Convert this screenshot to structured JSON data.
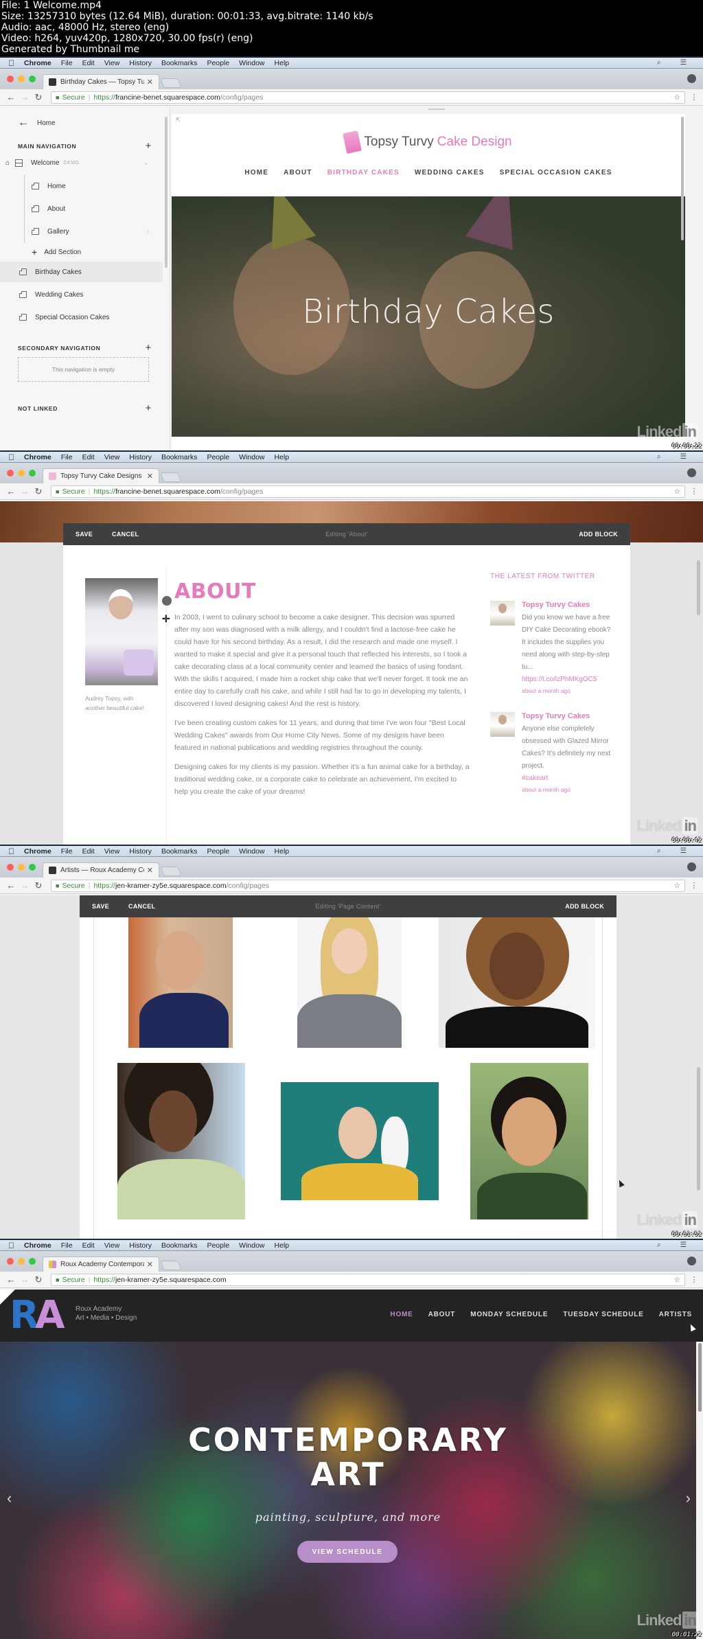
{
  "file_info": {
    "lines": [
      "File: 1 Welcome.mp4",
      "Size: 13257310 bytes (12.64 MiB), duration: 00:01:33, avg.bitrate: 1140 kb/s",
      "Audio: aac, 48000 Hz, stereo (eng)",
      "Video: h264, yuv420p, 1280x720, 30.00 fps(r) (eng)",
      "Generated by Thumbnail me"
    ]
  },
  "menubar": {
    "apple": "",
    "app": "Chrome",
    "items": [
      "File",
      "Edit",
      "View",
      "History",
      "Bookmarks",
      "People",
      "Window",
      "Help"
    ],
    "search_icon": "⌕",
    "list_icon": "☰"
  },
  "watermark": {
    "text": "Linked",
    "badge": "in"
  },
  "frames": [
    {
      "timestamp": "00:00:22",
      "tab_title": "Birthday Cakes — Topsy Turvy",
      "url": {
        "secure": "Secure",
        "scheme": "https://",
        "host": "francine-benet.squarespace.com",
        "path": "/config/pages"
      },
      "sidebar": {
        "home_label": "Home",
        "main_nav_label": "MAIN NAVIGATION",
        "welcome_label": "Welcome",
        "welcome_badge": "DEMO",
        "sub_items": [
          "Home",
          "About",
          "Gallery"
        ],
        "add_section": "Add Section",
        "pages": [
          "Birthday Cakes",
          "Wedding Cakes",
          "Special Occasion Cakes"
        ],
        "secondary_nav_label": "SECONDARY NAVIGATION",
        "secondary_empty": "This navigation is empty",
        "not_linked_label": "NOT LINKED"
      },
      "site": {
        "logo_main": "Topsy Turvy",
        "logo_accent": "Cake Design",
        "nav": [
          "HOME",
          "ABOUT",
          "BIRTHDAY CAKES",
          "WEDDING CAKES",
          "SPECIAL OCCASION CAKES"
        ],
        "active_nav": "BIRTHDAY CAKES",
        "hero_title": "Birthday Cakes"
      }
    },
    {
      "timestamp": "00:00:42",
      "tab_title": "Topsy Turvy Cake Designs",
      "url": {
        "secure": "Secure",
        "scheme": "https://",
        "host": "francine-benet.squarespace.com",
        "path": "/config/pages"
      },
      "editbar": {
        "save": "SAVE",
        "cancel": "CANCEL",
        "status": "Editing 'About'",
        "add_block": "ADD BLOCK"
      },
      "caption": "Audrey Topsy, with another beautiful cake!",
      "about_title": "ABOUT",
      "paragraphs": [
        "In 2003, I went to culinary school to become a cake designer. This decision was spurred after my son was diagnosed with a milk allergy, and I couldn't find a lactose-free cake he could have for his second birthday. As a result, I did the research and made one myself. I wanted to make it special and give it a personal touch that reflected his interests, so I took a cake decorating class at a local community center and learned the basics of using fondant. With the skills I acquired, I made him a rocket ship cake that we'll never forget. It took me an entire day to carefully craft his cake, and while I still had far to go in developing my talents, I discovered I loved designing cakes! And the rest is history.",
        "I've been creating custom cakes for 11 years, and during that time I've won four \"Best Local Wedding Cakes\" awards from Our Home City News. Some of my designs have been featured in national publications and wedding registries throughout the county.",
        "Designing cakes for my clients is my passion. Whether it's a fun animal cake for a birthday, a traditional wedding cake, or a corporate cake to celebrate an achievement, I'm excited to help you create the cake of your dreams!"
      ],
      "twitter": {
        "heading": "THE LATEST FROM TWITTER",
        "tweets": [
          {
            "name": "Topsy Turvy Cakes",
            "text": "Did you know we have a free DIY Cake Decorating ebook? It includes the supplies you need along with step-by-step tu...",
            "link": "https://t.co/lzPhMKgOC5",
            "time": "about a month ago"
          },
          {
            "name": "Topsy Turvy Cakes",
            "text": "Anyone else completely obsessed with Glazed Mirror Cakes? It's definitely my next project.",
            "link": "#cakeart",
            "time": "about a month ago"
          }
        ]
      }
    },
    {
      "timestamp": "00:01:02",
      "tab_title": "Artists — Roux Academy Cont",
      "url": {
        "secure": "Secure",
        "scheme": "https://",
        "host": "jen-kramer-zy5e.squarespace.com",
        "path": "/config/pages"
      },
      "editbar": {
        "save": "SAVE",
        "cancel": "CANCEL",
        "status": "Editing 'Page Content'",
        "add_block": "ADD BLOCK"
      },
      "artists": [
        "artist-1",
        "artist-2",
        "artist-3",
        "artist-4",
        "artist-5",
        "artist-6"
      ]
    },
    {
      "timestamp": "00:01:22",
      "tab_title": "Roux Academy Contemporary",
      "url": {
        "secure": "Secure",
        "scheme": "https://",
        "host": "jen-kramer-zy5e.squarespace.com",
        "path": ""
      },
      "site": {
        "logo_r": "R",
        "logo_a": "A",
        "name": "Roux Academy",
        "tagline": "Art • Media • Design",
        "nav": [
          "HOME",
          "ABOUT",
          "MONDAY SCHEDULE",
          "TUESDAY SCHEDULE",
          "ARTISTS"
        ],
        "active_nav": "HOME",
        "hero_title_1": "CONTEMPORARY",
        "hero_title_2": "ART",
        "hero_subtitle": "painting, sculpture, and more",
        "cta": "VIEW SCHEDULE",
        "prev_icon": "‹",
        "next_icon": "›"
      }
    }
  ],
  "colors": {
    "pink_accent": "#e57bbd",
    "ra_blue": "#2f73c8",
    "ra_purple": "#c88fd6",
    "cta_purple": "#b88ec8",
    "editor_bar": "#3f3f3f"
  }
}
